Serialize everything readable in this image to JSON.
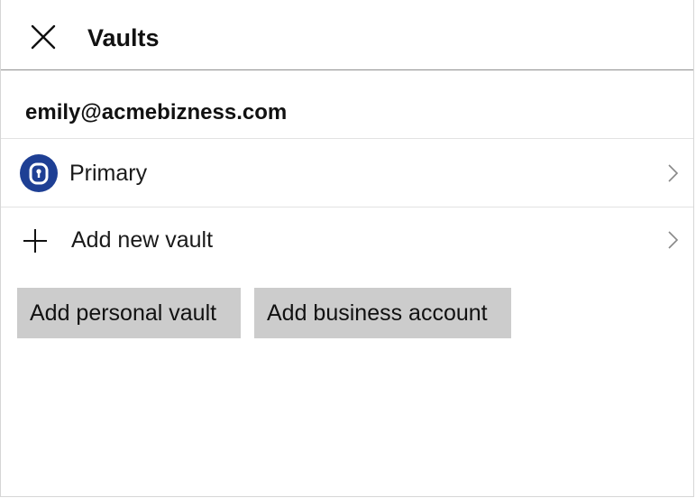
{
  "header": {
    "title": "Vaults",
    "close_icon": "close-icon"
  },
  "account": {
    "email": "emily@acmebizness.com"
  },
  "vaults": [
    {
      "label": "Primary",
      "icon": "vault-lock-icon",
      "icon_color": "#1e3f94"
    }
  ],
  "add_row": {
    "label": "Add new vault",
    "icon": "plus-icon"
  },
  "buttons": {
    "personal": "Add personal vault",
    "business": "Add business account"
  },
  "colors": {
    "button_bg": "#cccccc",
    "vault_icon": "#1e3f94"
  }
}
